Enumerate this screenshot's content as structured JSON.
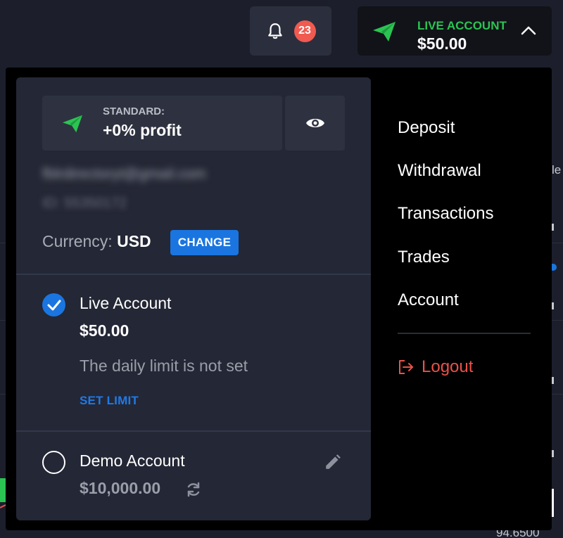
{
  "header": {
    "notifications_count": "23",
    "account_type": "LIVE ACCOUNT",
    "account_balance": "$50.00"
  },
  "panel": {
    "plan_label": "STANDARD:",
    "plan_value": "+0% profit",
    "email": "fblrdirectoryt@gmail.com",
    "user_id": "ID: 55350172",
    "currency_label": "Currency:",
    "currency_value": "USD",
    "change_label": "CHANGE",
    "accounts": [
      {
        "name": "Live Account",
        "balance": "$50.00",
        "limit_text": "The daily limit is not set",
        "set_limit_label": "SET LIMIT",
        "selected": true
      },
      {
        "name": "Demo Account",
        "balance": "$10,000.00",
        "selected": false
      }
    ]
  },
  "menu": {
    "items": [
      "Deposit",
      "Withdrawal",
      "Transactions",
      "Trades",
      "Account"
    ],
    "logout_label": "Logout"
  },
  "background": {
    "right_text_top": "le",
    "right_text_bottom": "94.6500"
  },
  "colors": {
    "accent_blue": "#1a75e0",
    "live_green": "#2bc453",
    "badge_red": "#f05a50",
    "logout_red": "#e8524a"
  },
  "icons": {
    "bell": "bell-icon",
    "plane": "paper-plane-icon",
    "chevron": "chevron-up-icon",
    "eye": "eye-icon",
    "check": "check-icon",
    "pencil": "pencil-icon",
    "refresh": "refresh-icon",
    "logout": "logout-icon"
  }
}
